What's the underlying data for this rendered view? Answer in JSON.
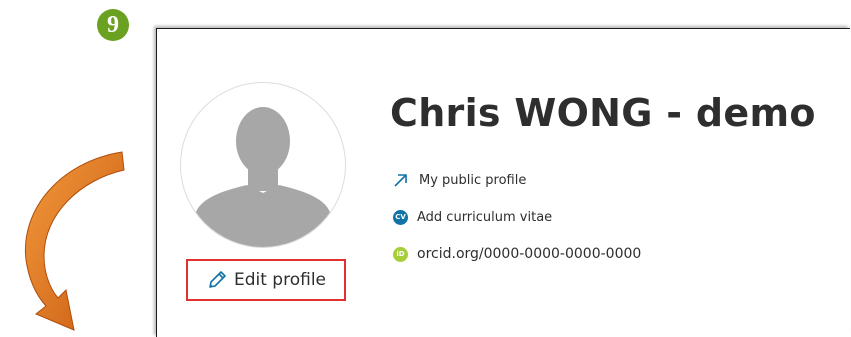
{
  "step_marker": {
    "number": "9",
    "color": "#6aa121"
  },
  "profile": {
    "name": "Chris WONG - demo",
    "avatar_icon": "default-person-avatar"
  },
  "links": [
    {
      "label": "My public profile",
      "icon": "external-link-icon",
      "color": "#1173a8"
    },
    {
      "label": "Add curriculum vitae",
      "icon": "cv-icon",
      "icon_text": "CV",
      "color": "#1173a8"
    },
    {
      "label": "orcid.org/0000-0000-0000-0000",
      "icon": "orcid-icon",
      "icon_text": "iD",
      "color": "#a6ce39"
    }
  ],
  "edit_button": {
    "label": "Edit profile",
    "icon": "pencil-icon",
    "highlight_color": "#e03131"
  },
  "annotation": {
    "icon": "curved-arrow-icon",
    "color": "#e06a1e"
  }
}
